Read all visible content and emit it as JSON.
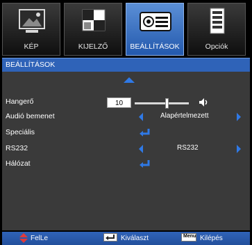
{
  "tabs": [
    {
      "label": "KÉP",
      "icon": "picture-icon",
      "active": false
    },
    {
      "label": "KIJELZŐ",
      "icon": "display-icon",
      "active": false
    },
    {
      "label": "BEÁLLÍTÁSOK",
      "icon": "projector-settings-icon",
      "active": true
    },
    {
      "label": "Opciók",
      "icon": "options-icon",
      "active": false
    }
  ],
  "menu": {
    "title": "BEÁLLÍTÁSOK",
    "items": [
      {
        "label": "Hangerő",
        "type": "slider",
        "value": "10",
        "level": 0.1
      },
      {
        "label": "Audió bemenet",
        "type": "select",
        "value": "Alapértelmezett"
      },
      {
        "label": "Speciális",
        "type": "enter"
      },
      {
        "label": "RS232",
        "type": "select",
        "value": "RS232"
      },
      {
        "label": "Hálózat",
        "type": "enter"
      }
    ]
  },
  "footer": {
    "updown": "FelLe",
    "select": "Kiválaszt",
    "menu_key": "Menu",
    "exit": "Kilépés"
  },
  "colors": {
    "accent": "#2f79e6",
    "tab_active": "#2359ad",
    "panel": "#3a3a3a",
    "footer": "#2f63b8"
  }
}
